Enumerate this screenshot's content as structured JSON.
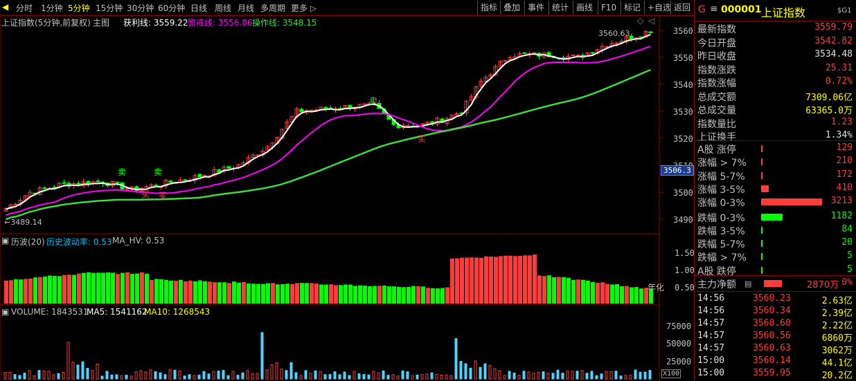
{
  "toolbar": {
    "periods": [
      "分时",
      "1分钟",
      "5分钟",
      "15分钟",
      "30分钟",
      "60分钟",
      "日线",
      "周线",
      "月线",
      "多周期",
      "更多 ▷"
    ],
    "active_period": "5分钟",
    "right_buttons": [
      "指标",
      "叠加",
      "事件",
      "统计",
      "画线",
      "F10",
      "标记",
      "+自选",
      "返回"
    ]
  },
  "main_header": {
    "title": "上证指数(5分钟,前复权)",
    "chart_label": "主图",
    "profit_label": "获利线: 3559.22",
    "warn_label": "警戒线: 3556.86",
    "op_label": "操作线: 3548.15"
  },
  "annotations": {
    "high_value": "3560.63",
    "low_value": "3489.14",
    "sell": "卖",
    "buy": "买",
    "cursor_price": "3506.3"
  },
  "price_axis": [
    "3560",
    "3550",
    "3540",
    "3530",
    "3520",
    "3510",
    "3500",
    "3490"
  ],
  "hv_header": {
    "title": "历波(20)",
    "hv_label": "历史波动率: 0.53",
    "ma_label": "MA_HV: 0.53",
    "side_text": "年化"
  },
  "hv_axis": [
    "1.50",
    "1.00",
    "0.50"
  ],
  "vol_header": {
    "title": "VOLUME: 1843531",
    "ma5": "MA5: 1541162",
    "ma10": "MA10: 1268543"
  },
  "vol_axis": [
    "75000",
    "50000",
    "25000"
  ],
  "vol_unit": "X100",
  "panel": {
    "badge": "G",
    "menu_icon": "≡",
    "code": "000001",
    "name": "上证指数",
    "tag": "$G1",
    "stats": [
      {
        "label": "最新指数",
        "value": "3559.79",
        "color": "#ff3c3c"
      },
      {
        "label": "今日开盘",
        "value": "3542.82",
        "color": "#ff3c3c"
      },
      {
        "label": "昨日收盘",
        "value": "3534.48",
        "color": "#e0e0e0"
      },
      {
        "label": "指数涨跌",
        "value": "25.31",
        "color": "#ff3c3c"
      },
      {
        "label": "指数涨幅",
        "value": "0.72%",
        "color": "#ff3c3c"
      },
      {
        "label": "总成交额",
        "value": "7309.06亿",
        "color": "#ffff00"
      },
      {
        "label": "总成交量",
        "value": "63365.0万",
        "color": "#ffff00"
      },
      {
        "label": "指数量比",
        "value": "1.23",
        "color": "#ff3c3c"
      },
      {
        "label": "上证换手",
        "value": "1.34%",
        "color": "#e0e0e0"
      }
    ],
    "breadth_up": [
      {
        "label": "A股 涨停",
        "value": "129",
        "bar": 0.02
      },
      {
        "label": "涨幅 > 7%",
        "value": "210",
        "bar": 0.02
      },
      {
        "label": "涨幅 5-7%",
        "value": "172",
        "bar": 0.02
      },
      {
        "label": "涨幅 3-5%",
        "value": "410",
        "bar": 0.1
      },
      {
        "label": "涨幅 0-3%",
        "value": "3213",
        "bar": 0.8
      }
    ],
    "breadth_down": [
      {
        "label": "跌幅 0-3%",
        "value": "1182",
        "bar": 0.28
      },
      {
        "label": "跌幅 3-5%",
        "value": "84",
        "bar": 0.02
      },
      {
        "label": "跌幅 5-7%",
        "value": "20",
        "bar": 0.005
      },
      {
        "label": "跌幅 > 7%",
        "value": "5",
        "bar": 0.005
      },
      {
        "label": "A股 跌停",
        "value": "5",
        "bar": 0.005
      }
    ],
    "main_flow": {
      "label": "主力净额",
      "value": "2870万",
      "pct": "0%"
    },
    "ticks": [
      {
        "time": "14:56",
        "price": "3560.23",
        "amount": "2.63亿"
      },
      {
        "time": "14:56",
        "price": "3560.34",
        "amount": "2.39亿"
      },
      {
        "time": "14:57",
        "price": "3560.60",
        "amount": "2.22亿"
      },
      {
        "time": "14:57",
        "price": "3560.56",
        "amount": "6860万"
      },
      {
        "time": "14:57",
        "price": "3560.63",
        "amount": "3062万"
      },
      {
        "time": "15:00",
        "price": "3560.14",
        "amount": "44.1亿"
      },
      {
        "time": "15:00",
        "price": "3559.95",
        "amount": "20.2亿"
      }
    ]
  },
  "colors": {
    "up": "#ff3c3c",
    "down": "#00ff00",
    "ma_white": "#ffffff",
    "ma_magenta": "#ff00ff",
    "ma_green": "#3cdc3c",
    "frame": "#8b0000"
  }
}
